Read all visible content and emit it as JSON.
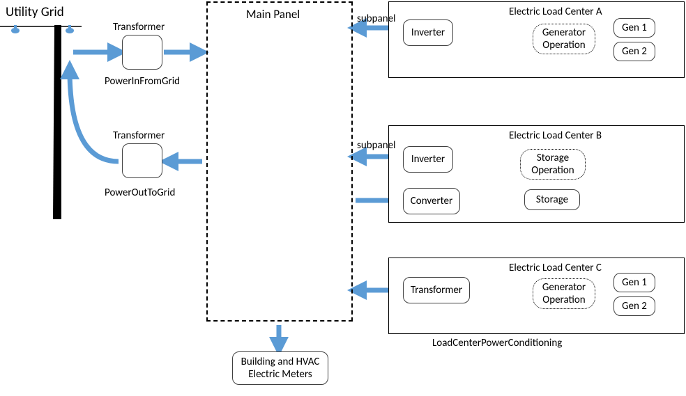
{
  "utilityGrid": {
    "label": "Utility Grid"
  },
  "transformerIn": {
    "label": "Transformer",
    "caption": "PowerInFromGrid"
  },
  "transformerOut": {
    "label": "Transformer",
    "caption": "PowerOutToGrid"
  },
  "mainPanel": {
    "title": "Main Panel"
  },
  "meters": {
    "label": "Building and HVAC\nElectric Meters"
  },
  "centers": {
    "a": {
      "title": "Electric Load Center A",
      "subpanel": "subpanel",
      "cond": "Inverter",
      "op": "Generator\nOperation",
      "gens": [
        "Gen 1",
        "Gen 2"
      ]
    },
    "b": {
      "title": "Electric Load Center B",
      "subpanel": "subpanel",
      "condIn": "Inverter",
      "condOut": "Converter",
      "op": "Storage\nOperation",
      "storage": "Storage"
    },
    "c": {
      "title": "Electric Load Center C",
      "cond": "Transformer",
      "op": "Generator\nOperation",
      "gens": [
        "Gen 1",
        "Gen 2"
      ],
      "footnote": "LoadCenterPowerConditioning"
    }
  }
}
